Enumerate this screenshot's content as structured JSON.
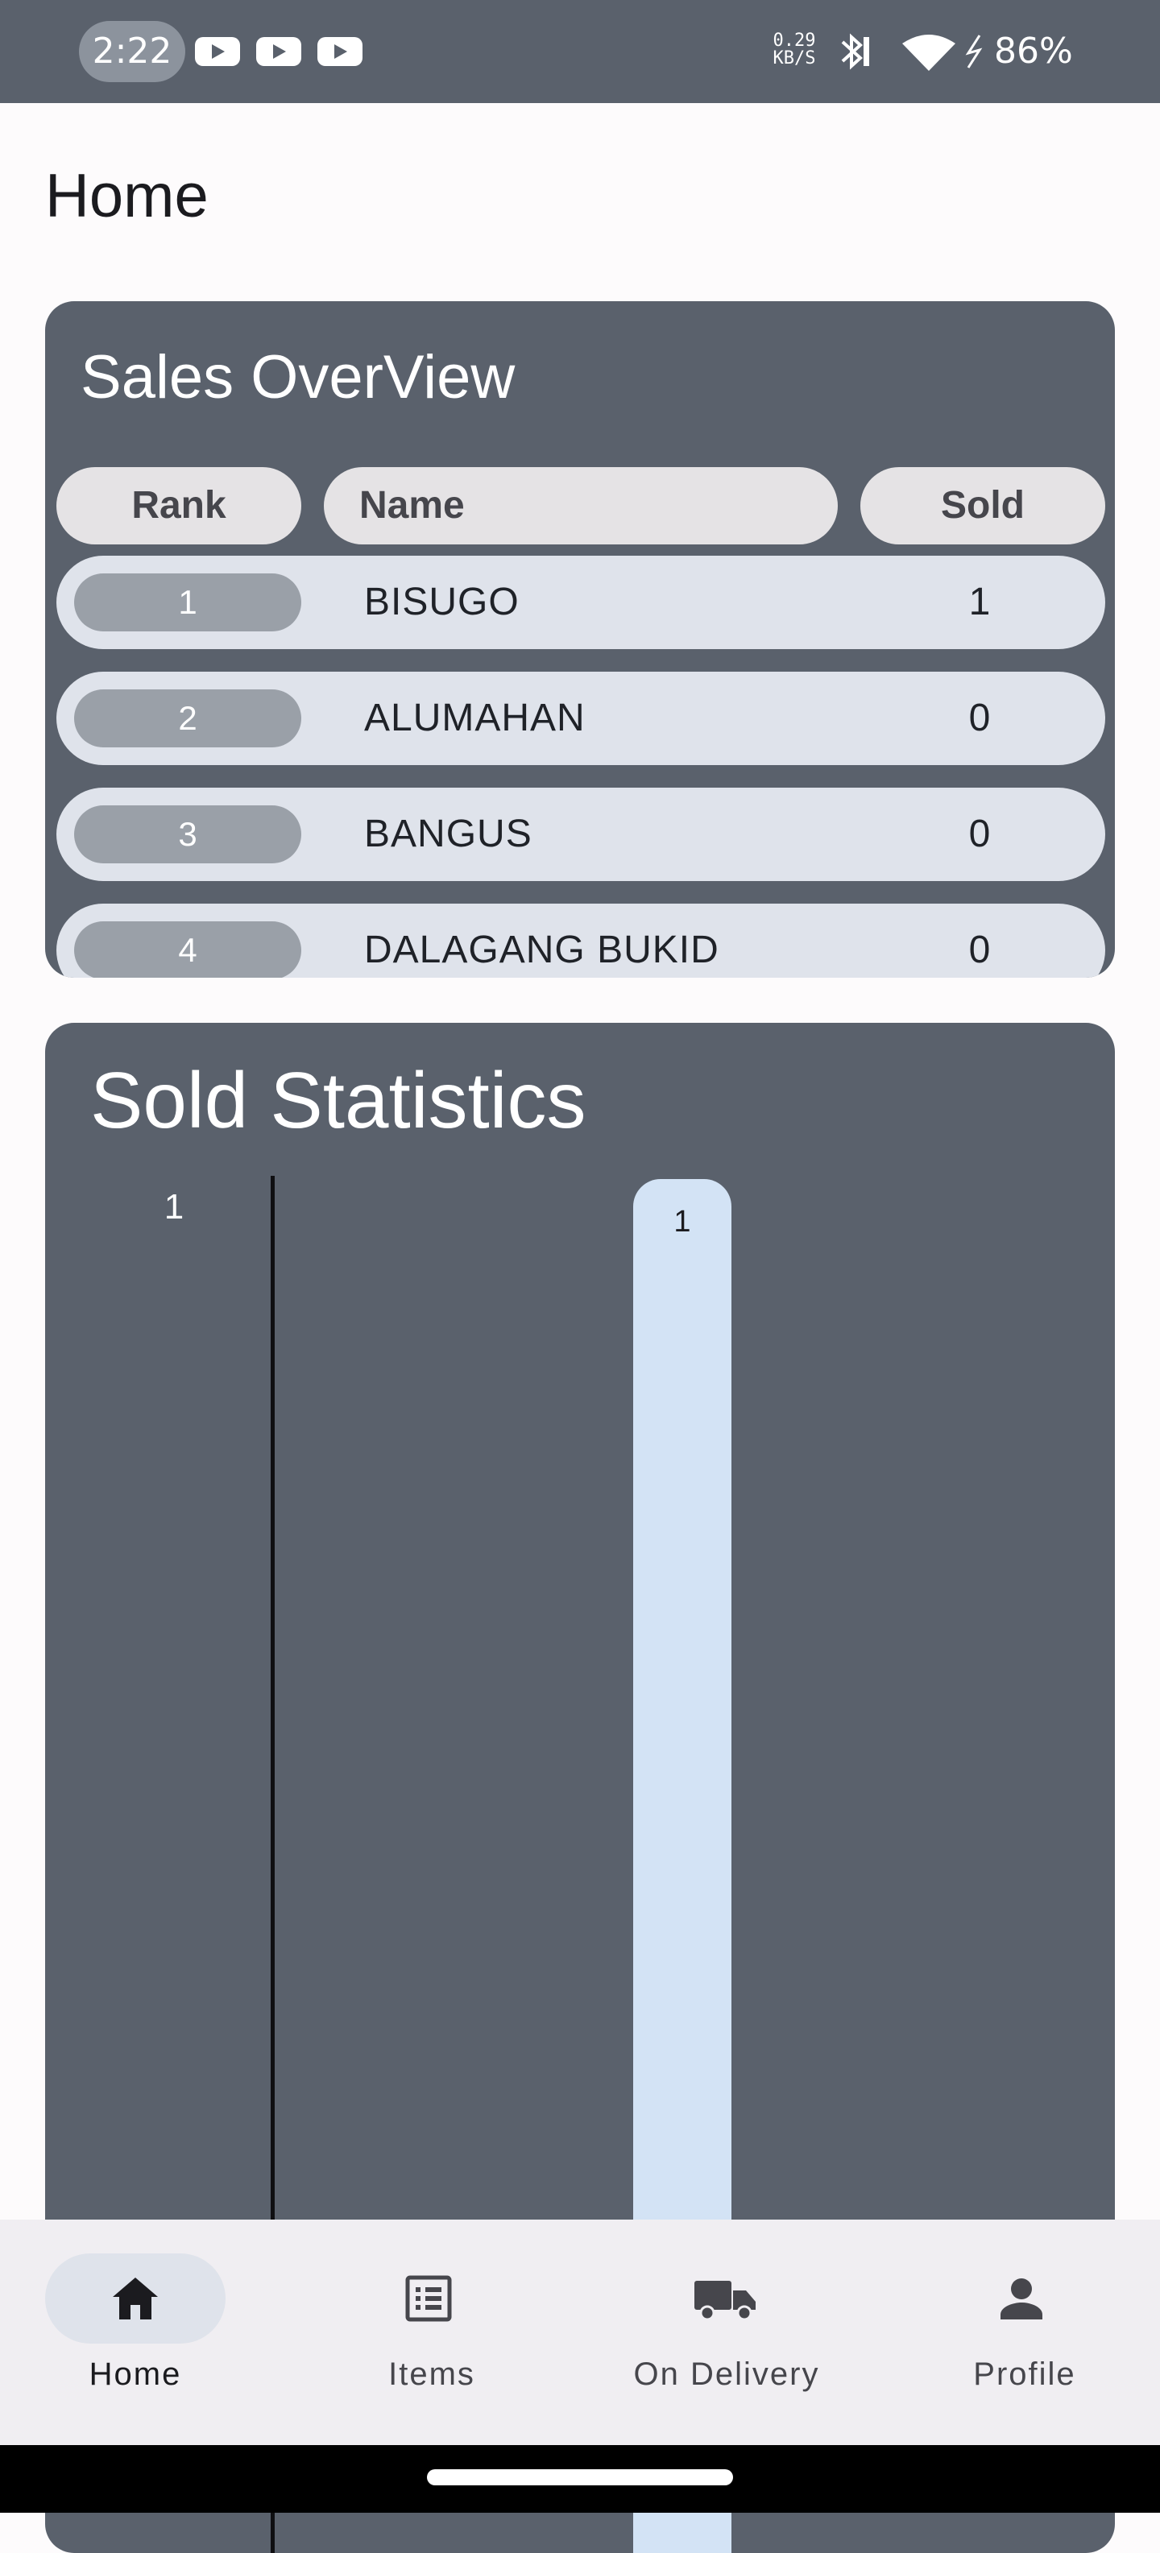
{
  "status_bar": {
    "time": "2:22",
    "net_speed_line1": "0.29",
    "net_speed_line2": "KB/S",
    "battery": "86%",
    "icons": [
      "youtube-icon",
      "youtube-icon",
      "youtube-icon",
      "bluetooth-icon",
      "wifi-icon",
      "charging-icon"
    ]
  },
  "page": {
    "title": "Home"
  },
  "sales_overview": {
    "title": "Sales OverView",
    "columns": {
      "rank": "Rank",
      "name": "Name",
      "sold": "Sold"
    },
    "rows": [
      {
        "rank": "1",
        "name": "BISUGO",
        "sold": "1"
      },
      {
        "rank": "2",
        "name": "ALUMAHAN",
        "sold": "0"
      },
      {
        "rank": "3",
        "name": "BANGUS",
        "sold": "0"
      },
      {
        "rank": "4",
        "name": "DALAGANG BUKID",
        "sold": "0"
      }
    ]
  },
  "sold_statistics": {
    "title": "Sold Statistics",
    "y_tick": "1",
    "bar_label": "1"
  },
  "chart_data": {
    "type": "bar",
    "values": [
      1
    ],
    "y_ticks": [
      "1"
    ],
    "data_labels": [
      "1"
    ]
  },
  "bottom_nav": {
    "items": [
      {
        "label": "Home",
        "icon": "home-icon",
        "active": true
      },
      {
        "label": "Items",
        "icon": "list-icon",
        "active": false
      },
      {
        "label": "On Delivery",
        "icon": "truck-icon",
        "active": false
      },
      {
        "label": "Profile",
        "icon": "person-icon",
        "active": false
      }
    ]
  },
  "colors": {
    "card": "#5A616C",
    "row": "#DFE3EB",
    "header_pill": "#E5E3E5",
    "rank_pill": "#9AA0A8",
    "bar": "#D3E3F5",
    "nav_background": "#F0EEF2"
  }
}
